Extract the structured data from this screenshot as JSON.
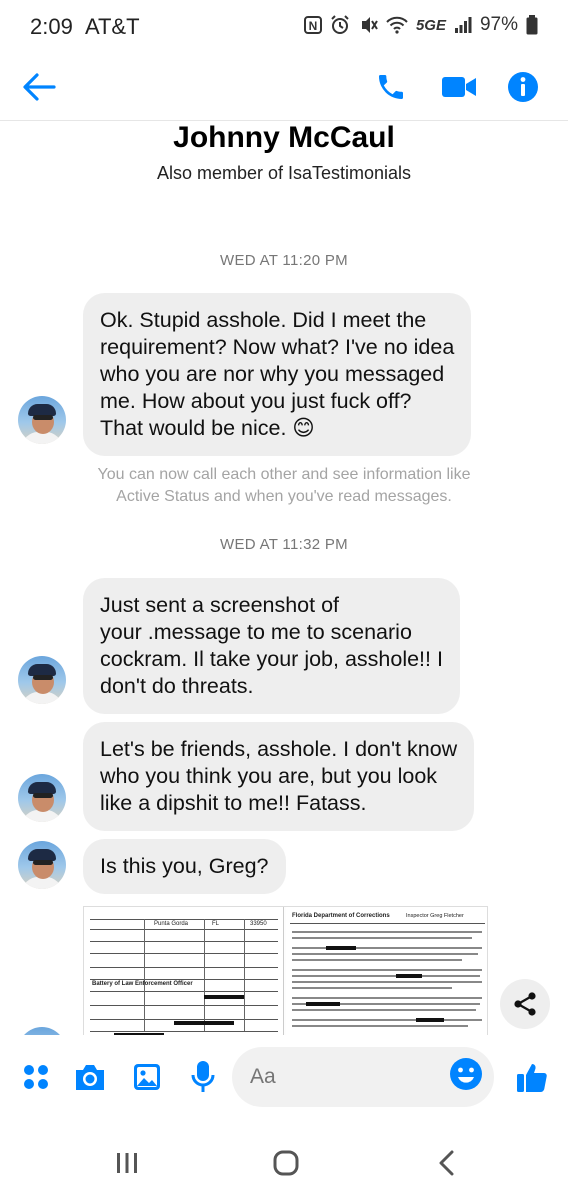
{
  "status_bar": {
    "time": "2:09",
    "carrier": "AT&T",
    "network": "5GE",
    "battery": "97%",
    "icons": [
      "nfc-icon",
      "alarm-icon",
      "vibrate-icon",
      "wifi-icon",
      "signal-icon",
      "battery-icon"
    ]
  },
  "header": {
    "back_icon": "back-arrow-icon",
    "call_icon": "phone-icon",
    "video_icon": "video-camera-icon",
    "info_icon": "info-icon"
  },
  "contact": {
    "name": "Johnny McCaul",
    "subtitle": "Also member of IsaTestimonials"
  },
  "messages": [
    {
      "type": "timestamp",
      "text": "WED AT 11:20 PM"
    },
    {
      "type": "incoming",
      "lines": [
        "Ok. Stupid asshole. Did I meet the",
        "requirement? Now what? I've no idea",
        "who you are nor why you messaged",
        "me. How about you just fuck off?",
        "That would be nice. 😊"
      ]
    },
    {
      "type": "system",
      "lines": [
        "You can now call each other and see information like",
        "Active Status and when you've read messages."
      ]
    },
    {
      "type": "timestamp",
      "text": "WED AT 11:32 PM"
    },
    {
      "type": "incoming",
      "lines": [
        "Just sent a screenshot of",
        "your .message to me to scenario",
        "cockram. Il take your job, asshole!! I",
        "don't do threats."
      ]
    },
    {
      "type": "incoming",
      "lines": [
        "Let's be friends, asshole. I don't know",
        "who you think you are, but you look",
        "like a dipshit to me!! Fatass."
      ]
    },
    {
      "type": "incoming",
      "lines": [
        "Is this you, Greg?"
      ]
    }
  ],
  "attachment": {
    "type": "image",
    "left_doc": {
      "place": "Punta Gorda",
      "state": "FL",
      "zip": "33950",
      "charge": "Battery of Law Enforcement Officer"
    },
    "right_doc": {
      "agency": "Florida Department of Corrections",
      "officer": "Inspector Greg Fletcher"
    }
  },
  "share_icon": "share-icon",
  "composer": {
    "placeholder": "Aa",
    "icons": [
      "apps-icon",
      "camera-icon",
      "gallery-icon",
      "microphone-icon",
      "emoji-icon",
      "thumbs-up-icon"
    ]
  },
  "nav": {
    "icons": [
      "recent-apps-icon",
      "home-icon",
      "back-icon"
    ]
  },
  "colors": {
    "accent": "#0084ff",
    "bubble": "#eeeeee",
    "meta_text": "#777777"
  }
}
